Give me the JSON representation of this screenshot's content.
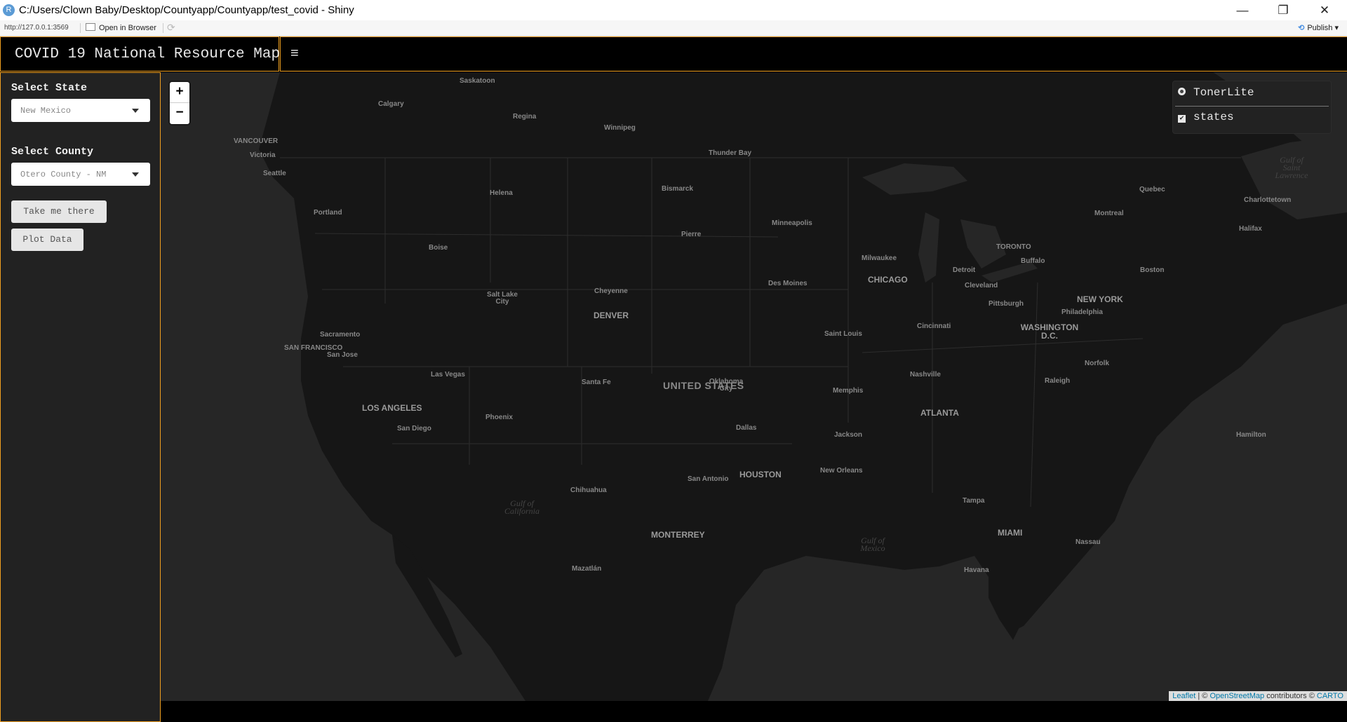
{
  "window": {
    "title": "C:/Users/Clown Baby/Desktop/Countyapp/Countyapp/test_covid - Shiny",
    "app_icon": "R",
    "minimize": "—",
    "maximize": "❐",
    "close": "✕"
  },
  "address": {
    "url": "http://127.0.0.1:3569",
    "open_in_browser": "Open in Browser",
    "publish": "Publish"
  },
  "header": {
    "brand": "COVID 19 National Resource Map",
    "menu_icon": "≡"
  },
  "sidebar": {
    "state_label": "Select State",
    "state_value": "New Mexico",
    "county_label": "Select County",
    "county_value": "Otero County - NM",
    "take_me_there": "Take me there",
    "plot_data": "Plot Data"
  },
  "map": {
    "zoom_in": "+",
    "zoom_out": "−",
    "layers": {
      "base": "TonerLite",
      "overlay": "states",
      "overlay_checked": true
    },
    "attribution": {
      "leaflet": "Leaflet",
      "osm": "OpenStreetMap",
      "contributors": "contributors ©",
      "carto": "CARTO"
    },
    "country": "UNITED STATES",
    "cities": [
      {
        "name": "Saskatoon",
        "big": false
      },
      {
        "name": "Calgary",
        "big": false
      },
      {
        "name": "Regina",
        "big": false
      },
      {
        "name": "Winnipeg",
        "big": false
      },
      {
        "name": "VANCOUVER",
        "big": false
      },
      {
        "name": "Victoria",
        "big": false
      },
      {
        "name": "Seattle",
        "big": false
      },
      {
        "name": "Thunder Bay",
        "big": false
      },
      {
        "name": "Helena",
        "big": false
      },
      {
        "name": "Bismarck",
        "big": false
      },
      {
        "name": "Quebec",
        "big": false
      },
      {
        "name": "Charlottetown",
        "big": false
      },
      {
        "name": "Portland",
        "big": false
      },
      {
        "name": "Montreal",
        "big": false
      },
      {
        "name": "Pierre",
        "big": false
      },
      {
        "name": "Minneapolis",
        "big": false
      },
      {
        "name": "Halifax",
        "big": false
      },
      {
        "name": "Boise",
        "big": false
      },
      {
        "name": "TORONTO",
        "big": false
      },
      {
        "name": "Milwaukee",
        "big": false
      },
      {
        "name": "Buffalo",
        "big": false
      },
      {
        "name": "Detroit",
        "big": false
      },
      {
        "name": "Boston",
        "big": false
      },
      {
        "name": "CHICAGO",
        "big": true
      },
      {
        "name": "Des Moines",
        "big": false
      },
      {
        "name": "Cleveland",
        "big": false
      },
      {
        "name": "Cheyenne",
        "big": false
      },
      {
        "name": "Salt Lake City",
        "big": false
      },
      {
        "name": "NEW YORK",
        "big": true
      },
      {
        "name": "Pittsburgh",
        "big": false
      },
      {
        "name": "Philadelphia",
        "big": false
      },
      {
        "name": "DENVER",
        "big": true
      },
      {
        "name": "WASHINGTON D.C.",
        "big": true
      },
      {
        "name": "Cincinnati",
        "big": false
      },
      {
        "name": "Sacramento",
        "big": false
      },
      {
        "name": "Saint Louis",
        "big": false
      },
      {
        "name": "SAN FRANCISCO",
        "big": false
      },
      {
        "name": "San Jose",
        "big": false
      },
      {
        "name": "Norfolk",
        "big": false
      },
      {
        "name": "Las Vegas",
        "big": false
      },
      {
        "name": "Nashville",
        "big": false
      },
      {
        "name": "Santa Fe",
        "big": false
      },
      {
        "name": "Oklahoma City",
        "big": false
      },
      {
        "name": "Raleigh",
        "big": false
      },
      {
        "name": "Memphis",
        "big": false
      },
      {
        "name": "LOS ANGELES",
        "big": true
      },
      {
        "name": "ATLANTA",
        "big": true
      },
      {
        "name": "Phoenix",
        "big": false
      },
      {
        "name": "San Diego",
        "big": false
      },
      {
        "name": "Dallas",
        "big": false
      },
      {
        "name": "Jackson",
        "big": false
      },
      {
        "name": "Hamilton",
        "big": false
      },
      {
        "name": "HOUSTON",
        "big": true
      },
      {
        "name": "New Orleans",
        "big": false
      },
      {
        "name": "San Antonio",
        "big": false
      },
      {
        "name": "Chihuahua",
        "big": false
      },
      {
        "name": "Tampa",
        "big": false
      },
      {
        "name": "MIAMI",
        "big": true
      },
      {
        "name": "Nassau",
        "big": false
      },
      {
        "name": "MONTERREY",
        "big": true
      },
      {
        "name": "Mazatlán",
        "big": false
      },
      {
        "name": "Havana",
        "big": false
      }
    ],
    "water": [
      "Gulf of Saint Lawrence",
      "Gulf of California",
      "Gulf of Mexico"
    ]
  }
}
